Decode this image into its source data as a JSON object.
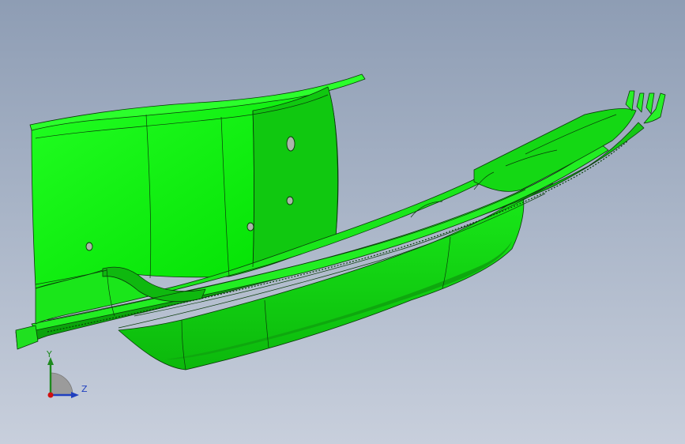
{
  "viewport": {
    "background_top": "#8e9db4",
    "background_bottom": "#c8cfdc",
    "model_color": "#00ee00",
    "edge_color": "#0a3a0a"
  },
  "triad": {
    "y_label": "Y",
    "z_label": "Z",
    "y_color": "#1e8a1e",
    "z_color": "#1f3fbf",
    "x_color": "#d01010"
  }
}
